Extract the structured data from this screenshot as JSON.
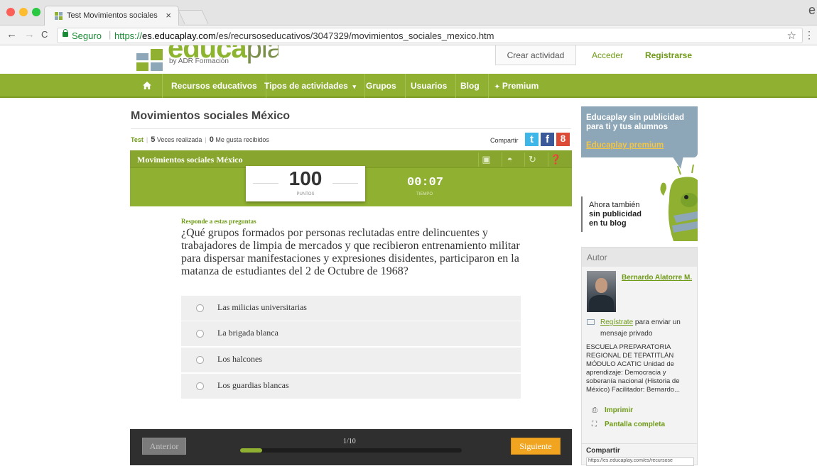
{
  "browser": {
    "tab_title": "Test Movimientos sociales Méx",
    "tab_close": "×",
    "secure_label": "Seguro",
    "url_protocol": "https://",
    "url_host": "es.educaplay.com",
    "url_path": "/es/recursoseducativos/3047329/movimientos_sociales_mexico.htm",
    "back": "←",
    "forward": "→",
    "reload": "C",
    "star": "☆",
    "menu": "⋮",
    "profile_letter": "e",
    "colors": {
      "close": "#fc5f57",
      "minimize": "#fdbc2e",
      "maximize": "#28c840"
    }
  },
  "site": {
    "logo_word_bold": "educa",
    "logo_word_light": "play",
    "logo_sub": "by ADR Formación",
    "header_buttons": {
      "create": "Crear actividad",
      "login": "Acceder",
      "register": "Registrarse"
    },
    "nav": {
      "home_icon": "home-icon",
      "items": [
        "Recursos educativos",
        "Tipos de actividades",
        "Grupos",
        "Usuarios",
        "Blog",
        "Premium"
      ],
      "dropdown_caret": "▾",
      "premium_star": "✦"
    },
    "brand_green": "#8fb030"
  },
  "activity": {
    "title": "Movimientos sociales México",
    "type": "Test",
    "times_done_count": "5",
    "times_done_label": "Veces realizada",
    "likes_count": "0",
    "likes_label": "Me gusta recibidos",
    "share_label": "Compartir",
    "social": [
      "t",
      "f",
      "8"
    ],
    "quiz_header_title": "Movimientos sociales México",
    "score": "100",
    "score_label": "PUNTOS",
    "timer": "00:07",
    "timer_label": "TIEMPO",
    "instruction": "Responde a estas preguntas",
    "question": "¿Qué grupos formados por personas reclutadas entre delincuentes y trabajadores de limpia de mercados y que recibieron entrenamiento militar para dispersar manifestaciones y expresiones disidentes, participaron en la matanza de estudiantes del 2 de Octubre de 1968?",
    "options": [
      "Las milicias universitarias",
      "La brigada blanca",
      "Los halcones",
      "Los guardias blancas"
    ],
    "prev_label": "Anterior",
    "next_label": "Siguiente",
    "progress_label": "1/10",
    "progress_fraction": 0.1
  },
  "sidebar": {
    "promo_line1": "Educaplay sin publicidad para ti y tus alumnos",
    "promo_link": "Educaplay premium",
    "promo_line2a": "Ahora también",
    "promo_line2b": "sin publicidad",
    "promo_line2c": "en tu blog",
    "author_title": "Autor",
    "author_name": "Bernardo Alatorre M.",
    "register_link": "Regístrate",
    "register_rest": " para enviar un mensaje privado",
    "author_description": "ESCUELA PREPARATORIA REGIONAL DE TEPATITLÁN MÓDULO ACATIC Unidad de aprendizaje: Democracia y soberanía nacional (Historia de México) Facilitador: Bernardo...",
    "print_label": "Imprimir",
    "fullscreen_label": "Pantalla completa",
    "share_title": "Compartir",
    "share_url": "https://es.educaplay.com/es/recursose"
  }
}
